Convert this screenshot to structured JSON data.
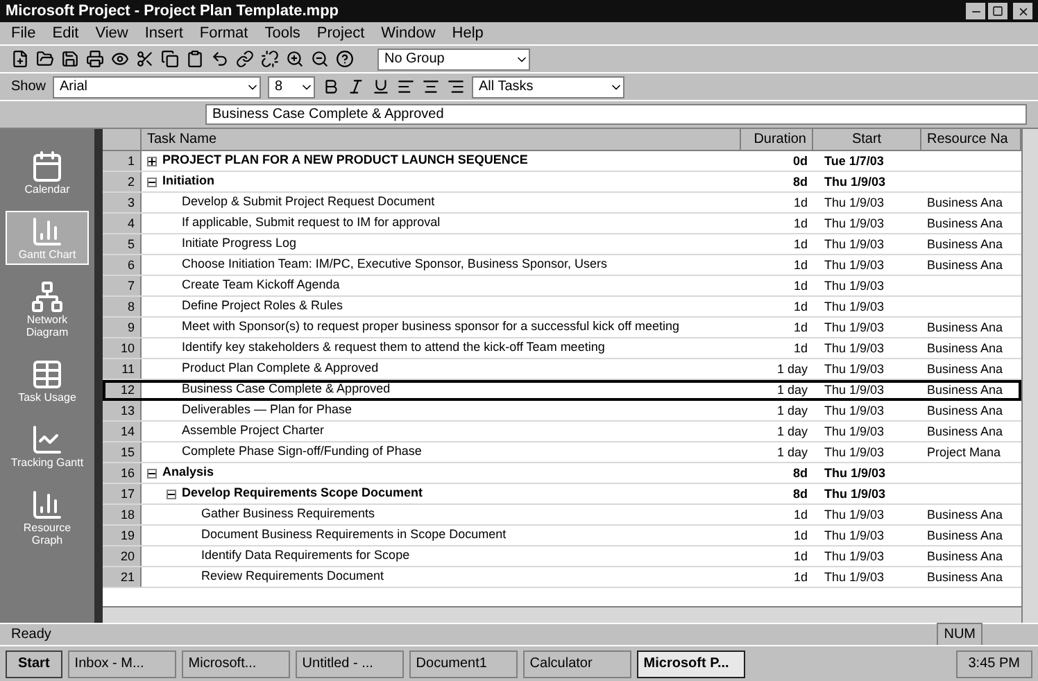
{
  "window": {
    "title": "Microsoft Project - Project Plan Template.mpp"
  },
  "menu": [
    "File",
    "Edit",
    "View",
    "Insert",
    "Format",
    "Tools",
    "Project",
    "Window",
    "Help"
  ],
  "standard_toolbar": {
    "group": "No Group"
  },
  "formatting_toolbar": {
    "show": "Show",
    "font": "Arial",
    "size": "8",
    "filter": "All Tasks"
  },
  "entry_bar": {
    "value": "Business Case Complete & Approved"
  },
  "view_bar": [
    {
      "label": "Calendar",
      "selected": false
    },
    {
      "label": "Gantt Chart",
      "selected": true
    },
    {
      "label": "Network Diagram",
      "selected": false
    },
    {
      "label": "Task Usage",
      "selected": false
    },
    {
      "label": "Tracking Gantt",
      "selected": false
    },
    {
      "label": "Resource Graph",
      "selected": false
    }
  ],
  "table": {
    "columns": [
      "Task Name",
      "Duration",
      "Start",
      "Resource Na"
    ],
    "rows": [
      {
        "id": "1",
        "name": "PROJECT PLAN FOR A NEW PRODUCT LAUNCH SEQUENCE",
        "summary": true,
        "expanded": false,
        "selected": false,
        "duration": "0d",
        "start": "Tue 1/7/03"
      },
      {
        "id": "2",
        "name": "Initiation",
        "summary": true,
        "expanded": true,
        "selected": false,
        "duration": "8d",
        "start": "Thu 1/9/03",
        "children": [
          {
            "id": "3",
            "name": "Develop & Submit Project Request Document",
            "summary": false,
            "selected": false,
            "duration": "1d",
            "start": "Thu 1/9/03",
            "resources": "Business Ana"
          },
          {
            "id": "4",
            "name": "If applicable, Submit request to IM for approval",
            "summary": false,
            "selected": false,
            "duration": "1d",
            "start": "Thu 1/9/03",
            "resources": "Business Ana"
          },
          {
            "id": "5",
            "name": "Initiate Progress Log",
            "summary": false,
            "selected": false,
            "duration": "1d",
            "start": "Thu 1/9/03",
            "resources": "Business Ana"
          },
          {
            "id": "6",
            "name": "Choose Initiation Team: IM/PC, Executive Sponsor, Business Sponsor, Users",
            "summary": false,
            "selected": false,
            "duration": "1d",
            "start": "Thu 1/9/03",
            "resources": "Business Ana"
          },
          {
            "id": "7",
            "name": "Create Team Kickoff Agenda",
            "summary": false,
            "selected": false,
            "duration": "1d",
            "start": "Thu 1/9/03"
          },
          {
            "id": "8",
            "name": "Define Project Roles & Rules",
            "summary": false,
            "selected": false,
            "duration": "1d",
            "start": "Thu 1/9/03"
          },
          {
            "id": "9",
            "name": "Meet with Sponsor(s) to request proper business sponsor for a successful kick off meeting",
            "summary": false,
            "selected": false,
            "duration": "1d",
            "start": "Thu 1/9/03",
            "resources": "Business Ana"
          },
          {
            "id": "10",
            "name": "Identify key stakeholders & request them to attend the kick-off Team meeting",
            "summary": false,
            "selected": false,
            "duration": "1d",
            "start": "Thu 1/9/03",
            "resources": "Business Ana"
          },
          {
            "id": "11",
            "name": "Product Plan Complete & Approved",
            "summary": false,
            "selected": false,
            "duration": "1 day",
            "start": "Thu 1/9/03",
            "resources": "Business Ana"
          },
          {
            "id": "12",
            "name": "Business Case Complete & Approved",
            "summary": false,
            "selected": true,
            "duration": "1 day",
            "start": "Thu 1/9/03",
            "resources": "Business Ana"
          },
          {
            "id": "13",
            "name": "Deliverables — Plan for Phase",
            "summary": false,
            "selected": false,
            "duration": "1 day",
            "start": "Thu 1/9/03",
            "resources": "Business Ana"
          },
          {
            "id": "14",
            "name": "Assemble Project Charter",
            "summary": false,
            "selected": false,
            "duration": "1 day",
            "start": "Thu 1/9/03",
            "resources": "Business Ana"
          },
          {
            "id": "15",
            "name": "Complete Phase Sign-off/Funding of Phase",
            "summary": false,
            "selected": false,
            "duration": "1 day",
            "start": "Thu 1/9/03",
            "resources": "Project Mana"
          }
        ]
      },
      {
        "id": "16",
        "name": "Analysis",
        "summary": true,
        "expanded": true,
        "selected": false,
        "duration": "8d",
        "start": "Thu 1/9/03",
        "children": [
          {
            "id": "17",
            "name": "Develop Requirements Scope Document",
            "summary": true,
            "expanded": true,
            "selected": false,
            "duration": "8d",
            "start": "Thu 1/9/03",
            "children": [
              {
                "id": "18",
                "name": "Gather Business Requirements",
                "summary": false,
                "selected": false,
                "duration": "1d",
                "start": "Thu 1/9/03",
                "resources": "Business Ana"
              },
              {
                "id": "19",
                "name": "Document Business Requirements in Scope Document",
                "summary": false,
                "selected": false,
                "duration": "1d",
                "start": "Thu 1/9/03",
                "resources": "Business Ana"
              },
              {
                "id": "20",
                "name": "Identify Data Requirements for Scope",
                "summary": false,
                "selected": false,
                "duration": "1d",
                "start": "Thu 1/9/03",
                "resources": "Business Ana"
              },
              {
                "id": "21",
                "name": "Review Requirements Document",
                "summary": false,
                "selected": false,
                "duration": "1d",
                "start": "Thu 1/9/03",
                "resources": "Business Ana"
              }
            ]
          }
        ]
      }
    ]
  },
  "status_bar": {
    "text": "Ready",
    "indicator": "NUM"
  },
  "taskbar": {
    "start": "Start",
    "buttons": [
      {
        "label": "Inbox - M...",
        "selected": false
      },
      {
        "label": "Microsoft...",
        "selected": false
      },
      {
        "label": "Untitled - ...",
        "selected": false
      },
      {
        "label": "Document1",
        "selected": false
      },
      {
        "label": "Calculator",
        "selected": false
      },
      {
        "label": "Microsoft P...",
        "selected": true
      }
    ],
    "clock": "3:45 PM"
  }
}
